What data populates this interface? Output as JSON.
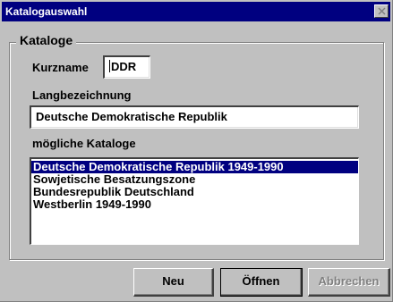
{
  "window": {
    "title": "Katalogauswahl"
  },
  "group": {
    "legend": "Kataloge"
  },
  "kurzname": {
    "label": "Kurzname",
    "value": "DDR"
  },
  "langbezeichnung": {
    "label": "Langbezeichnung",
    "value": "Deutsche Demokratische Republik"
  },
  "kataloge": {
    "label": "mögliche Kataloge",
    "items": [
      {
        "label": "Deutsche Demokratische Republik 1949-1990"
      },
      {
        "label": "Sowjetische Besatzungszone"
      },
      {
        "label": "Bundesrepublik Deutschland"
      },
      {
        "label": "Westberlin 1949-1990"
      }
    ],
    "selected": "Deutsche Demokratische Republik 1949-1990"
  },
  "buttons": {
    "neu": "Neu",
    "oeffnen": "Öffnen",
    "abbrechen": "Abbrechen"
  },
  "colors": {
    "title_bar": "#000080",
    "face": "#c0c0c0",
    "selection": "#000080"
  }
}
